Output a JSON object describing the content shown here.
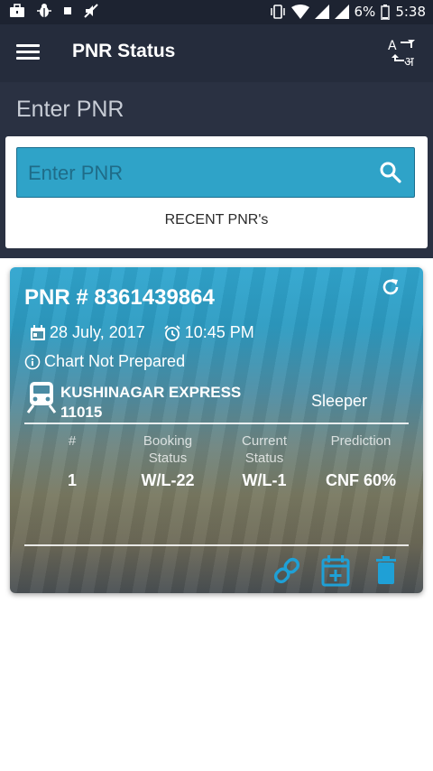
{
  "status_bar": {
    "battery": "6%",
    "time": "5:38",
    "left_icons": [
      "briefcase-icon",
      "bug-icon",
      "square-icon",
      "no-sound-icon"
    ],
    "right_icons": [
      "vibrate-icon",
      "wifi-icon",
      "signal-icon",
      "signal-icon",
      "battery-icon"
    ]
  },
  "app_bar": {
    "title": "PNR Status",
    "menu_icon": "hamburger-menu-icon",
    "translate_icon": "translate-icon",
    "translate_top": "A",
    "translate_bottom": "अ"
  },
  "enter_section": {
    "heading": "Enter PNR",
    "search_placeholder": "Enter PNR",
    "search_value": "",
    "recent_label": "RECENT PNR's"
  },
  "pnr_card": {
    "title": "PNR # 8361439864",
    "date": "28 July, 2017",
    "time": "10:45 PM",
    "chart_status": "Chart Not Prepared",
    "train_name": "KUSHINAGAR EXPRESS",
    "train_number": "11015",
    "travel_class": "Sleeper",
    "table": {
      "headers": [
        "#",
        "Booking\nStatus",
        "Current\nStatus",
        "Prediction"
      ],
      "rows": [
        [
          "1",
          "W/L-22",
          "W/L-1",
          "CNF 60%"
        ]
      ]
    },
    "actions": [
      "link-icon",
      "calendar-add-icon",
      "delete-icon"
    ]
  },
  "colors": {
    "status_bar_bg": "#1d2331",
    "app_bar_bg": "#252c3c",
    "section_bg": "#2a3142",
    "accent": "#2fa3c8",
    "icon_accent": "#1fa0d6"
  }
}
